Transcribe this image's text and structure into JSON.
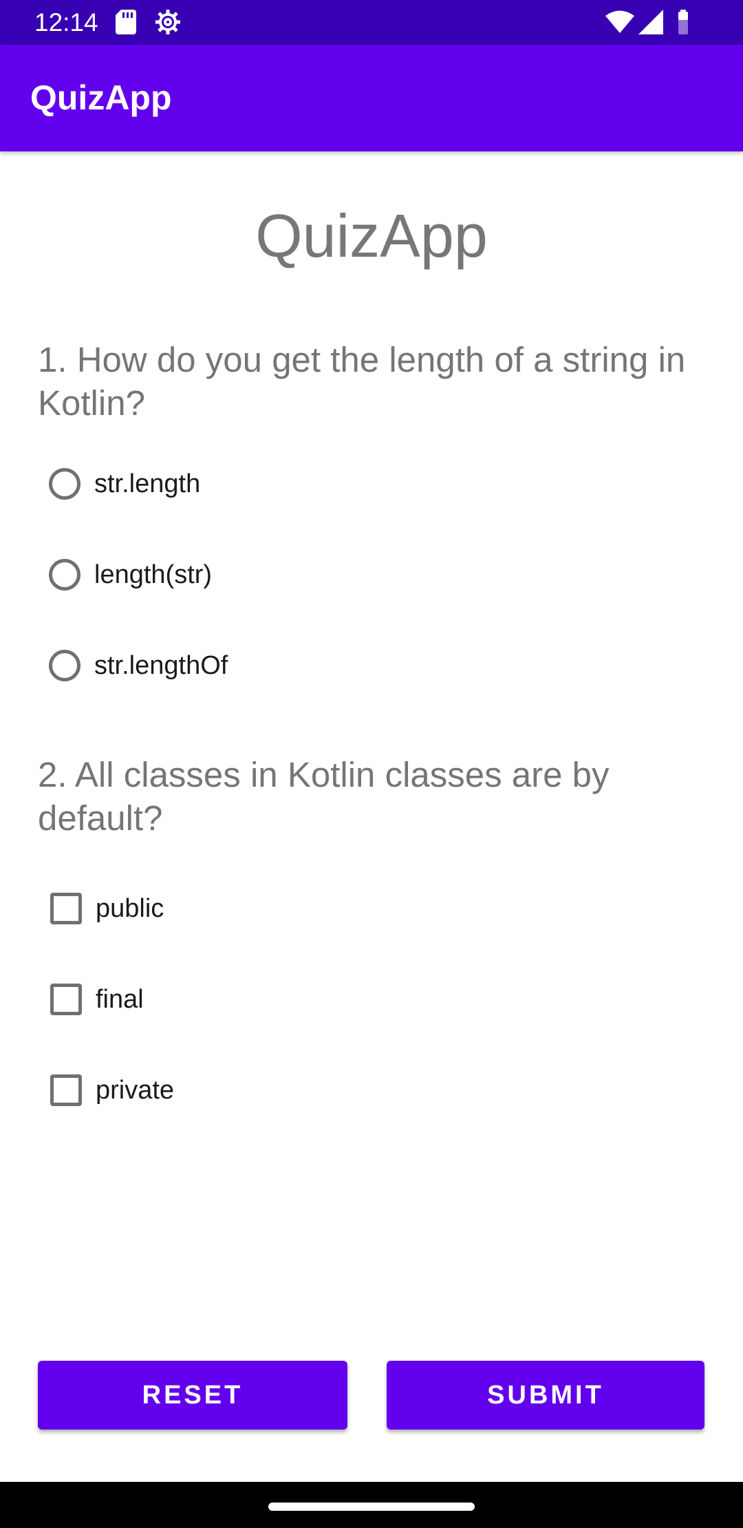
{
  "status_bar": {
    "time": "12:14",
    "icons_left": [
      "sd-card-icon",
      "settings-icon"
    ],
    "icons_right": [
      "wifi-icon",
      "signal-icon",
      "battery-icon"
    ]
  },
  "app_bar": {
    "title": "QuizApp"
  },
  "page_title": "QuizApp",
  "questions": [
    {
      "text": "1. How do you get the length of a string in Kotlin?",
      "type": "radio",
      "options": [
        "str.length",
        "length(str)",
        "str.lengthOf"
      ]
    },
    {
      "text": "2. All classes in Kotlin classes are by default?",
      "type": "checkbox",
      "options": [
        "public",
        "final",
        "private"
      ]
    }
  ],
  "buttons": {
    "reset": "RESET",
    "submit": "SUBMIT"
  },
  "colors": {
    "primary": "#6200ee",
    "primary_dark": "#3700b3",
    "question_text": "#757575"
  }
}
